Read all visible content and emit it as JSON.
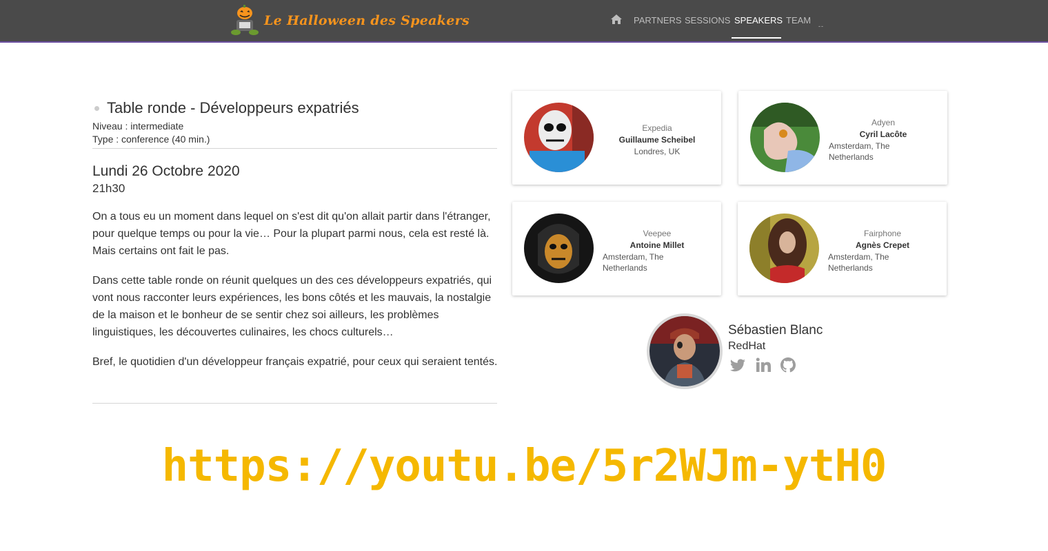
{
  "nav": {
    "brand": "Le Halloween des Speakers",
    "links": [
      {
        "label": "PARTNERS",
        "active": false
      },
      {
        "label": "SESSIONS",
        "active": false
      },
      {
        "label": "SPEAKERS",
        "active": true
      },
      {
        "label": "TEAM",
        "active": false
      }
    ],
    "more": "--"
  },
  "session": {
    "title": "Table ronde - Développeurs expatriés",
    "level": "Niveau : intermediate",
    "type": "Type : conference (40 min.)",
    "date": "Lundi 26 Octobre 2020",
    "time": "21h30",
    "paragraphs": [
      "On a tous eu un moment dans lequel on s'est dit qu'on allait partir dans l'étranger, pour quelque temps ou pour la vie… Pour la plupart parmi nous, cela est resté là. Mais certains ont fait le pas.",
      "Dans cette table ronde on réunit quelques un des ces développeurs expatriés, qui vont nous racconter leurs expériences, les bons côtés et les mauvais, la nostalgie de la maison et le bonheur de se sentir chez soi ailleurs, les problèmes linguistiques, les découvertes culinaires, les chocs culturels…",
      "Bref, le quotidien d'un développeur français expatrié, pour ceux qui seraient tentés."
    ]
  },
  "speakers": [
    {
      "company": "Expedia",
      "name": "Guillaume Scheibel",
      "location": "Londres, UK"
    },
    {
      "company": "Adyen",
      "name": "Cyril Lacôte",
      "location": "Amsterdam, The Netherlands"
    },
    {
      "company": "Veepee",
      "name": "Antoine Millet",
      "location": "Amsterdam, The Netherlands"
    },
    {
      "company": "Fairphone",
      "name": "Agnès Crepet",
      "location": "Amsterdam, The Netherlands"
    }
  ],
  "featured": {
    "name": "Sébastien Blanc",
    "company": "RedHat",
    "social": [
      "twitter-icon",
      "linkedin-icon",
      "github-icon"
    ]
  },
  "banner": {
    "url": "https://youtu.be/5r2WJm-ytH0"
  },
  "colors": {
    "navbar": "#4a4a4a",
    "brand": "#f7941d",
    "banner": "#f5b800",
    "nav_border": "#6b4fa0"
  }
}
